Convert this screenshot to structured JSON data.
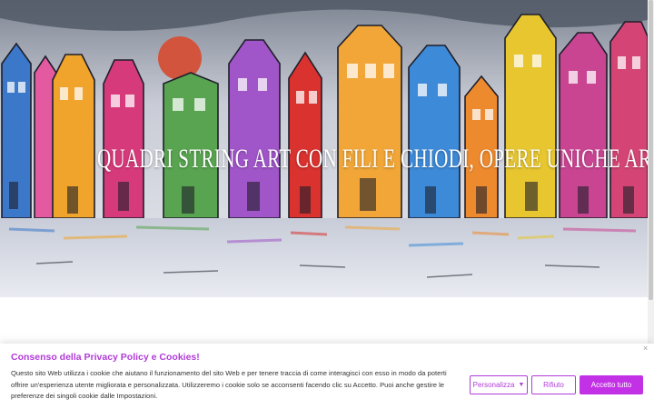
{
  "hero": {
    "title": "QUADRI STRING ART CON FILI E CHIODI, OPERE UNICHE ARREDO MODERNO CONTEMPORANEO"
  },
  "cookie_banner": {
    "title": "Consenso della Privacy Policy e Cookies!",
    "text": "Questo sito Web utilizza i cookie che aiutano il funzionamento del sito Web e per tenere traccia di come interagisci con esso in modo da poterti offrire un'esperienza utente migliorata e personalizzata. Utilizzeremo i cookie solo se acconsenti facendo clic su Accetto. Puoi anche gestire le preferenze dei singoli cookie dalle Impostazioni.",
    "close_label": "×",
    "customize_label": "Personalizza",
    "reject_label": "Rifiuto",
    "accept_label": "Accetto tutto",
    "accent_color": "#c331e6"
  }
}
